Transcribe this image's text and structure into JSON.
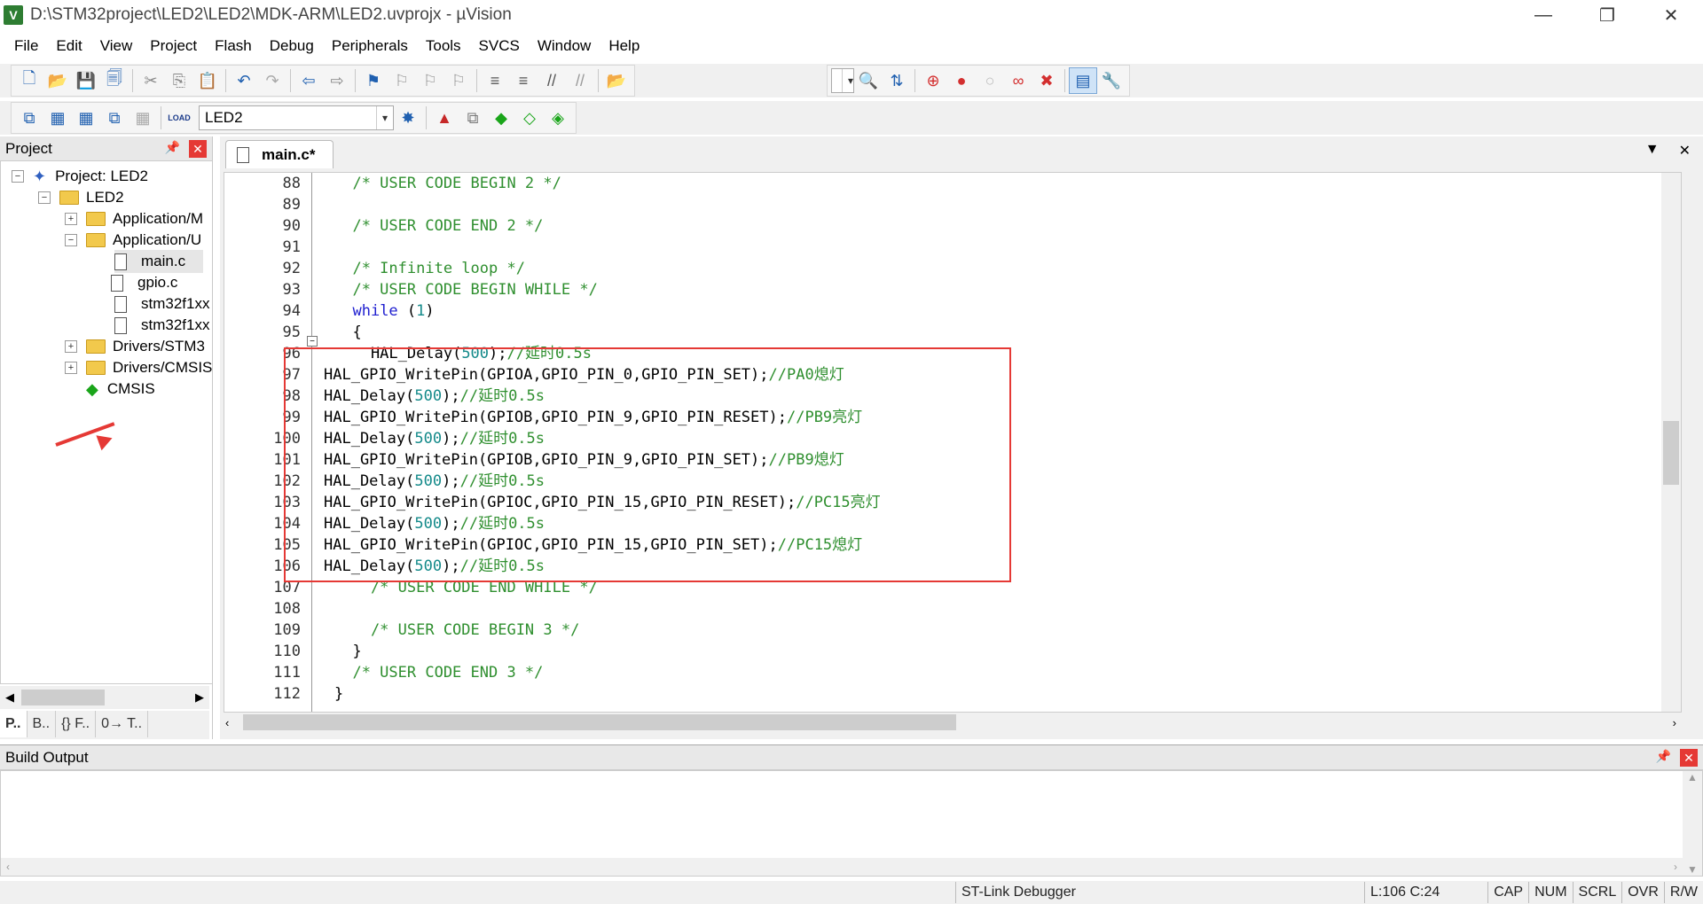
{
  "window": {
    "title": "D:\\STM32project\\LED2\\LED2\\MDK-ARM\\LED2.uvprojx - µVision",
    "app_icon": "V"
  },
  "menu": [
    "File",
    "Edit",
    "View",
    "Project",
    "Flash",
    "Debug",
    "Peripherals",
    "Tools",
    "SVCS",
    "Window",
    "Help"
  ],
  "toolbar2": {
    "target": "LED2",
    "load_label": "LOAD"
  },
  "project_panel": {
    "title": "Project",
    "tree": [
      {
        "label": "Project: LED2",
        "icon": "gear-icon"
      },
      {
        "label": "LED2",
        "icon": "folder-icon"
      },
      {
        "label": "Application/M",
        "icon": "folder-icon"
      },
      {
        "label": "Application/U",
        "icon": "folder-icon"
      },
      {
        "label": "main.c",
        "icon": "file-icon"
      },
      {
        "label": "gpio.c",
        "icon": "file-icon"
      },
      {
        "label": "stm32f1xx",
        "icon": "file-icon"
      },
      {
        "label": "stm32f1xx",
        "icon": "file-icon"
      },
      {
        "label": "Drivers/STM3",
        "icon": "folder-icon"
      },
      {
        "label": "Drivers/CMSIS",
        "icon": "folder-icon"
      },
      {
        "label": "CMSIS",
        "icon": "diamond-icon"
      }
    ],
    "tabs": [
      "P..",
      "B..",
      "{} F..",
      "0→ T.."
    ]
  },
  "editor": {
    "tab_label": "main.c*",
    "lines": [
      {
        "n": "88",
        "text": "  /* USER CODE BEGIN 2 */",
        "cls": "cmt"
      },
      {
        "n": "89",
        "text": "",
        "cls": ""
      },
      {
        "n": "90",
        "text": "  /* USER CODE END 2 */",
        "cls": "cmt"
      },
      {
        "n": "91",
        "text": "",
        "cls": ""
      },
      {
        "n": "92",
        "text": "  /* Infinite loop */",
        "cls": "cmt"
      },
      {
        "n": "93",
        "text": "  /* USER CODE BEGIN WHILE */",
        "cls": "cmt"
      },
      {
        "n": "94",
        "text": "  while (1)",
        "cls": "kw"
      },
      {
        "n": "95",
        "text": "  {",
        "cls": ""
      },
      {
        "n": "96",
        "text": "    HAL_Delay(500);//延时0.5s",
        "cls": ""
      },
      {
        "n": "97",
        "text": "HAL_GPIO_WritePin(GPIOA,GPIO_PIN_0,GPIO_PIN_SET);//PA0熄灯",
        "cls": ""
      },
      {
        "n": "98",
        "text": "HAL_Delay(500);//延时0.5s",
        "cls": ""
      },
      {
        "n": "99",
        "text": "HAL_GPIO_WritePin(GPIOB,GPIO_PIN_9,GPIO_PIN_RESET);//PB9亮灯",
        "cls": ""
      },
      {
        "n": "100",
        "text": "HAL_Delay(500);//延时0.5s",
        "cls": ""
      },
      {
        "n": "101",
        "text": "HAL_GPIO_WritePin(GPIOB,GPIO_PIN_9,GPIO_PIN_SET);//PB9熄灯",
        "cls": ""
      },
      {
        "n": "102",
        "text": "HAL_Delay(500);//延时0.5s",
        "cls": ""
      },
      {
        "n": "103",
        "text": "HAL_GPIO_WritePin(GPIOC,GPIO_PIN_15,GPIO_PIN_RESET);//PC15亮灯",
        "cls": ""
      },
      {
        "n": "104",
        "text": "HAL_Delay(500);//延时0.5s",
        "cls": ""
      },
      {
        "n": "105",
        "text": "HAL_GPIO_WritePin(GPIOC,GPIO_PIN_15,GPIO_PIN_SET);//PC15熄灯",
        "cls": ""
      },
      {
        "n": "106",
        "text": "HAL_Delay(500);//延时0.5s",
        "cls": ""
      },
      {
        "n": "107",
        "text": "    /* USER CODE END WHILE */",
        "cls": "cmt"
      },
      {
        "n": "108",
        "text": "",
        "cls": ""
      },
      {
        "n": "109",
        "text": "    /* USER CODE BEGIN 3 */",
        "cls": "cmt"
      },
      {
        "n": "110",
        "text": "  }",
        "cls": ""
      },
      {
        "n": "111",
        "text": "  /* USER CODE END 3 */",
        "cls": "cmt"
      },
      {
        "n": "112",
        "text": "}",
        "cls": ""
      }
    ]
  },
  "build_output": {
    "title": "Build Output"
  },
  "statusbar": {
    "debugger": "ST-Link Debugger",
    "position": "L:106 C:24",
    "flags": [
      "CAP",
      "NUM",
      "SCRL",
      "OVR",
      "R/W"
    ]
  },
  "colors": {
    "accent_red": "#e53935",
    "comment_green": "#2f8f2f",
    "keyword_blue": "#2020d0",
    "number_teal": "#148a8a"
  }
}
